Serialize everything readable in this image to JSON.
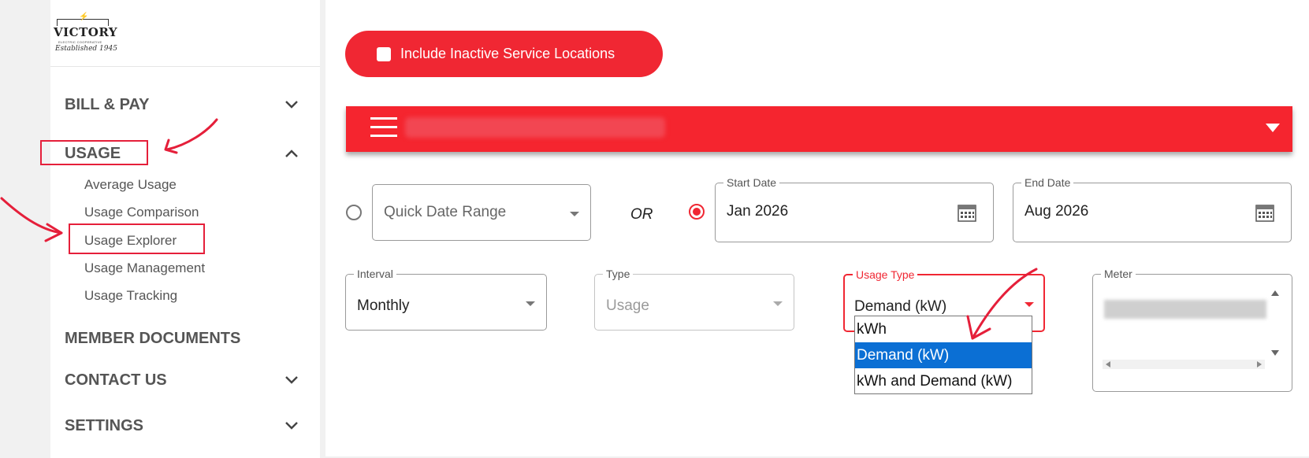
{
  "logo": {
    "name": "VICTORY",
    "tagline": "ELECTRIC COOPERATIVE",
    "established": "Established 1945"
  },
  "sidebar": {
    "bill_pay": "BILL & PAY",
    "usage": "USAGE",
    "usage_sub": [
      "Average Usage",
      "Usage Comparison",
      "Usage Explorer",
      "Usage Management",
      "Usage Tracking"
    ],
    "member_documents": "MEMBER DOCUMENTS",
    "contact_us": "CONTACT US",
    "settings": "SETTINGS"
  },
  "main": {
    "include_inactive_label": "Include Inactive Service Locations",
    "include_inactive_checked": false,
    "quick_date_range_placeholder": "Quick Date Range",
    "or_label": "OR",
    "start_date": {
      "label": "Start Date",
      "value": "Jan 2026"
    },
    "end_date": {
      "label": "End Date",
      "value": "Aug 2026"
    },
    "interval": {
      "label": "Interval",
      "value": "Monthly"
    },
    "type": {
      "label": "Type",
      "value": "Usage"
    },
    "usage_type": {
      "label": "Usage Type",
      "value": "Demand (kW)",
      "options": [
        "kWh",
        "Demand (kW)",
        "kWh and Demand (kW)"
      ],
      "selected_index": 1
    },
    "meter": {
      "label": "Meter"
    }
  },
  "colors": {
    "brand_red": "#f02733",
    "selection_blue": "#0b6fd4",
    "annotation_red": "#e51f3a"
  }
}
